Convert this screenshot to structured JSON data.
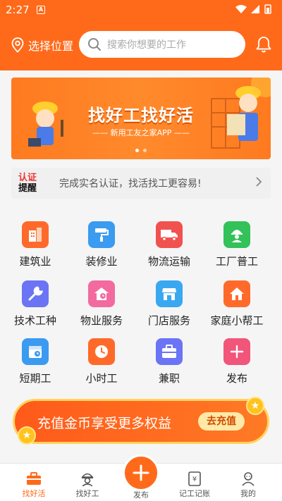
{
  "status_bar": {
    "time": "2:27",
    "badge": "A"
  },
  "header": {
    "location_label": "选择位置",
    "search_placeholder": "搜索你想要的工作"
  },
  "banner": {
    "title": "找好工找好活",
    "subtitle": "—— 新用工友之家APP ——"
  },
  "verify": {
    "tag_line1": "认证",
    "tag_line2": "提醒",
    "message": "完成实名认证，找活找工更容易!"
  },
  "categories": [
    {
      "label": "建筑业",
      "icon": "building-icon",
      "color": "#ff6a2a"
    },
    {
      "label": "装修业",
      "icon": "paint-roller-icon",
      "color": "#3a9bf0"
    },
    {
      "label": "物流运输",
      "icon": "truck-icon",
      "color": "#f0524f"
    },
    {
      "label": "工厂普工",
      "icon": "worker-icon",
      "color": "#33c15a"
    },
    {
      "label": "技术工种",
      "icon": "wrench-icon",
      "color": "#6b74f4"
    },
    {
      "label": "物业服务",
      "icon": "home-clock-icon",
      "color": "#f26aa0"
    },
    {
      "label": "门店服务",
      "icon": "store-icon",
      "color": "#3aa8f0"
    },
    {
      "label": "家庭小帮工",
      "icon": "house-icon",
      "color": "#ff6a2a"
    },
    {
      "label": "短期工",
      "icon": "calendar-icon",
      "color": "#3a9bf0"
    },
    {
      "label": "小时工",
      "icon": "clock-icon",
      "color": "#ff6a2a"
    },
    {
      "label": "兼职",
      "icon": "briefcase-icon",
      "color": "#6b74f4"
    },
    {
      "label": "发布",
      "icon": "plus-icon",
      "color": "#f2557a"
    }
  ],
  "recharge": {
    "text": "充值金币享受更多权益",
    "button": "去充值"
  },
  "nav": {
    "items": [
      {
        "label": "找好活",
        "icon": "toolbox-icon",
        "active": true
      },
      {
        "label": "找好工",
        "icon": "worker-helmet-icon",
        "active": false
      },
      {
        "label": "发布",
        "icon": "plus-icon",
        "active": false
      },
      {
        "label": "记工记账",
        "icon": "ledger-icon",
        "active": false
      },
      {
        "label": "我的",
        "icon": "profile-icon",
        "active": false
      }
    ]
  },
  "colors": {
    "primary": "#ff6a1a",
    "gold": "#ffd45c"
  }
}
